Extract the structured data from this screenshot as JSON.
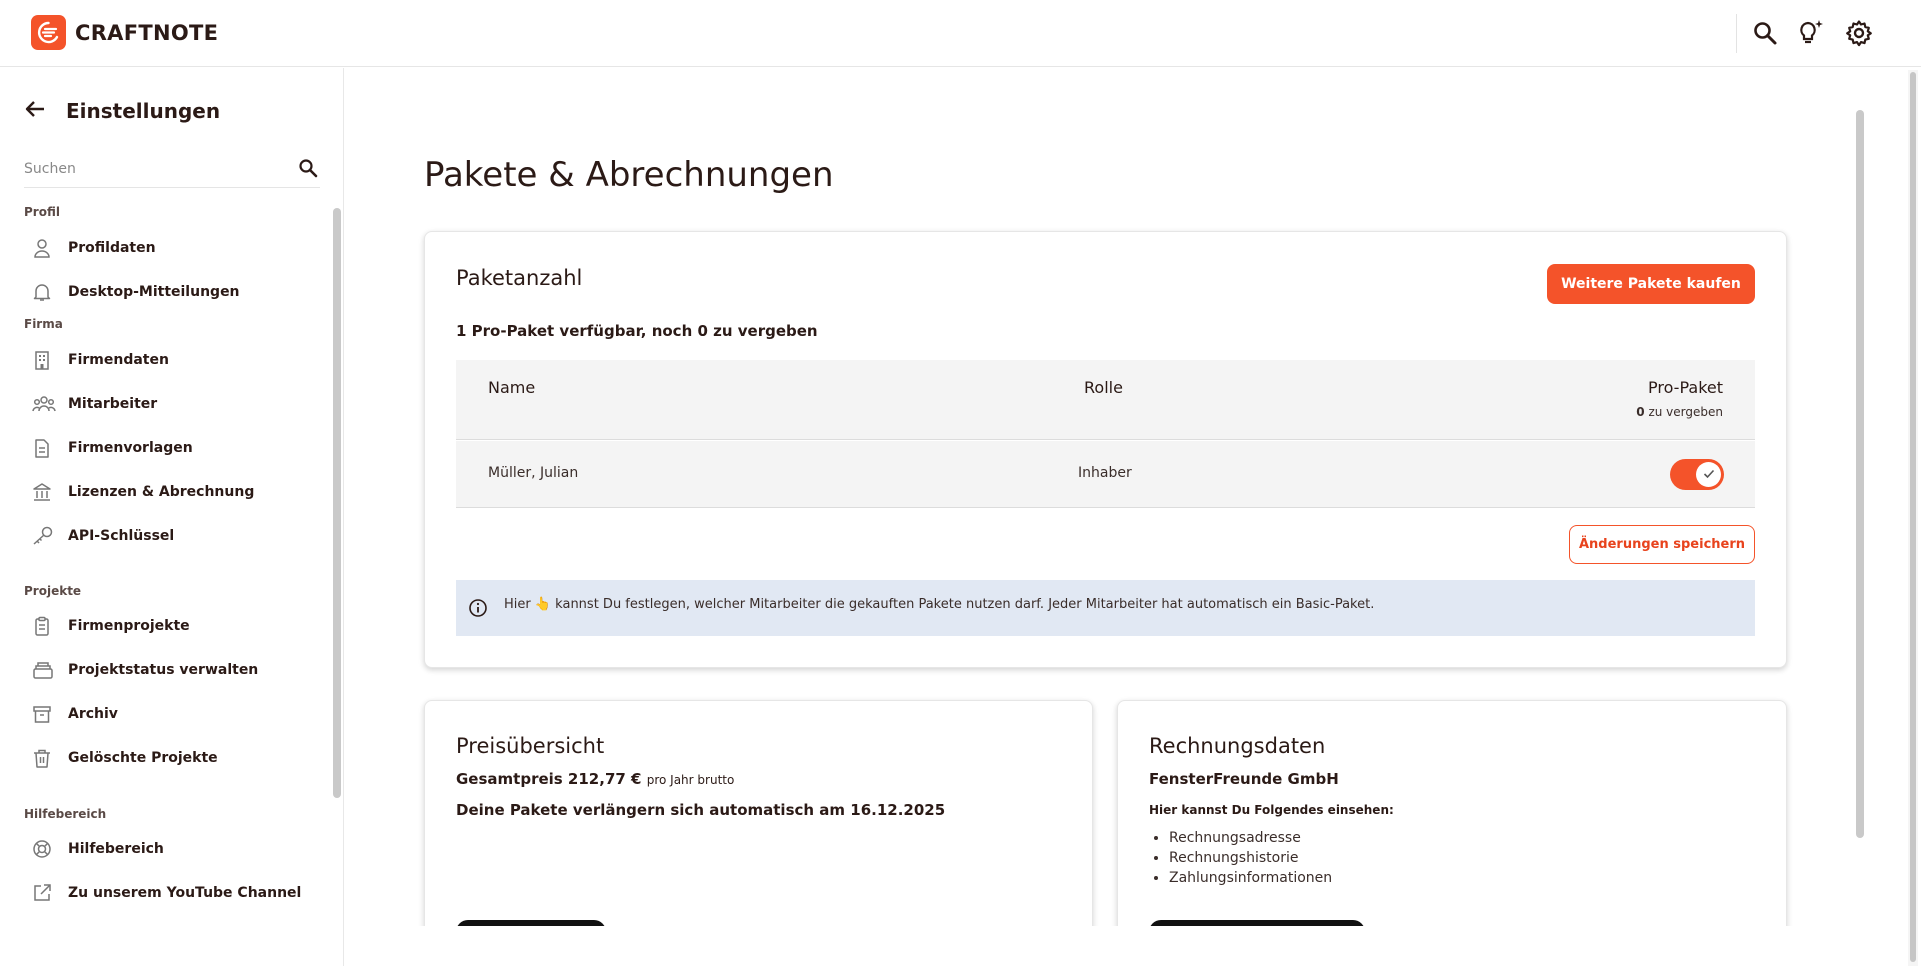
{
  "app": {
    "name": "CRAFTNOTE"
  },
  "topbar": {
    "icons": [
      "search-icon",
      "lightbulb-sparkle-icon",
      "gear-icon"
    ]
  },
  "sidebar": {
    "title": "Einstellungen",
    "search": {
      "placeholder": "Suchen",
      "value": ""
    },
    "sections": {
      "profil": "Profil",
      "firma": "Firma",
      "projekte": "Projekte",
      "hilfe": "Hilfebereich"
    },
    "items": {
      "profildaten": "Profildaten",
      "desktop": "Desktop-Mitteilungen",
      "firmendaten": "Firmendaten",
      "mitarbeiter": "Mitarbeiter",
      "firmenvorlagen": "Firmenvorlagen",
      "lizenzen": "Lizenzen & Abrechnung",
      "api": "API-Schlüssel",
      "firmenprojekte": "Firmenprojekte",
      "projektstatus": "Projektstatus verwalten",
      "archiv": "Archiv",
      "geloescht": "Gelöschte Projekte",
      "hilfebereich": "Hilfebereich",
      "youtube": "Zu unserem YouTube Channel"
    }
  },
  "main": {
    "title": "Pakete & Abrechnungen",
    "paketanzahl": {
      "title": "Paketanzahl",
      "buy_button": "Weitere Pakete kaufen",
      "available": "1 Pro-Paket verfügbar, noch 0 zu vergeben",
      "columns": {
        "name": "Name",
        "role": "Rolle",
        "pro": "Pro-Paket"
      },
      "pro_sub_count": "0",
      "pro_sub_text": " zu vergeben",
      "rows": [
        {
          "name": "Müller, Julian",
          "role": "Inhaber",
          "pro_enabled": true
        }
      ],
      "save_button": "Änderungen speichern",
      "info_text": "Hier 👆 kannst Du festlegen, welcher Mitarbeiter die gekauften Pakete nutzen darf. Jeder Mitarbeiter hat automatisch ein Basic-Paket."
    },
    "preis": {
      "title": "Preisübersicht",
      "total_label": "Gesamtpreis 212,77 €",
      "total_suffix": "pro Jahr brutto",
      "renewal": "Deine Pakete verlängern sich automatisch am 16.12.2025"
    },
    "rechnung": {
      "title": "Rechnungsdaten",
      "company": "FensterFreunde GmbH",
      "intro": "Hier kannst Du Folgendes einsehen:",
      "items": [
        "Rechnungsadresse",
        "Rechnungshistorie",
        "Zahlungsinformationen"
      ]
    }
  },
  "colors": {
    "accent": "#f4532a",
    "info_bg": "#e1e8f3",
    "text": "#2b1a16"
  }
}
